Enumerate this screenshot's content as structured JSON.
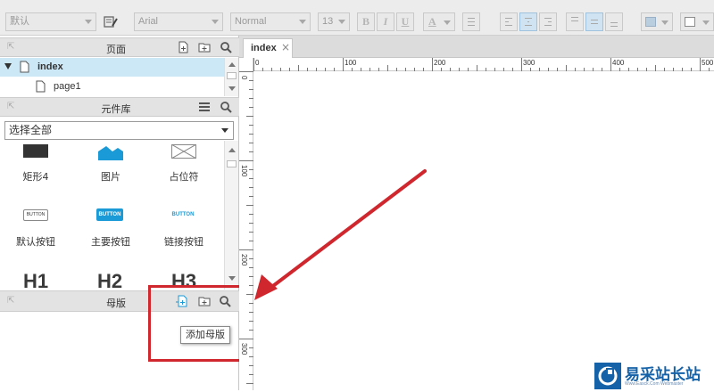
{
  "toolbar": {
    "style_select": "默认",
    "font_family": "Arial",
    "font_weight": "Normal",
    "font_size": "13",
    "bold": "B",
    "italic": "I",
    "underline": "U",
    "font_color": "A"
  },
  "pages_panel": {
    "title": "页面",
    "items": [
      {
        "label": "index",
        "selected": true
      },
      {
        "label": "page1",
        "selected": false
      }
    ]
  },
  "library_panel": {
    "title": "元件库",
    "filter": "选择全部",
    "widgets_row1": [
      "矩形4",
      "图片",
      "占位符"
    ],
    "widgets_row2": [
      "默认按钮",
      "主要按钮",
      "链接按钮"
    ],
    "button_preview_text": "BUTTON",
    "widgets_row3": [
      "H1",
      "H2",
      "H3"
    ]
  },
  "masters_panel": {
    "title": "母版",
    "tooltip": "添加母版"
  },
  "canvas": {
    "tab_label": "index",
    "tab_close": "×",
    "h_ruler_labels": [
      "0",
      "100",
      "200",
      "300",
      "400",
      "500"
    ],
    "v_ruler_labels": [
      "0",
      "100",
      "200",
      "300"
    ]
  },
  "watermark": {
    "text": "易采站长站",
    "sub": "Www.Easck.Com Webmaster"
  },
  "colors": {
    "annotation_red": "#d0262d",
    "selection_blue": "#cce8f7",
    "accent_blue": "#1a9ad6",
    "watermark_blue": "#1562a8"
  }
}
